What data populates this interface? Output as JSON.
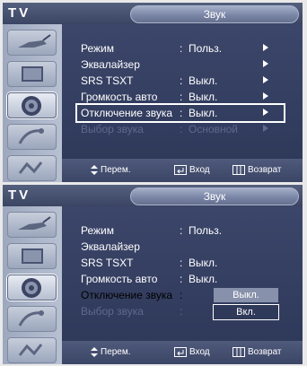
{
  "screens": [
    {
      "tv_label": "TV",
      "title": "Звук",
      "rows": [
        {
          "label": "Режим",
          "sep": ":",
          "value": "Польз."
        },
        {
          "label": "Эквалайзер",
          "sep": "",
          "value": ""
        },
        {
          "label": "SRS TSXT",
          "sep": ":",
          "value": "Выкл."
        },
        {
          "label": "Громкость авто",
          "sep": ":",
          "value": "Выкл."
        },
        {
          "label": "Отключение звука",
          "sep": ":",
          "value": "Выкл."
        },
        {
          "label": "Выбор звука",
          "sep": ":",
          "value": "Основной"
        }
      ],
      "footer": {
        "move": "Перем.",
        "enter": "Вход",
        "return": "Возврат"
      }
    },
    {
      "tv_label": "TV",
      "title": "Звук",
      "rows": [
        {
          "label": "Режим",
          "sep": ":",
          "value": "Польз."
        },
        {
          "label": "Эквалайзер",
          "sep": "",
          "value": ""
        },
        {
          "label": "SRS TSXT",
          "sep": ":",
          "value": "Выкл."
        },
        {
          "label": "Громкость авто",
          "sep": ":",
          "value": "Выкл."
        },
        {
          "label": "Отключение звука",
          "sep": ":",
          "value": ""
        },
        {
          "label": "Выбор звука",
          "sep": ":",
          "value": ""
        }
      ],
      "dropdown": {
        "options": [
          "Выкл.",
          "Вкл."
        ],
        "selected": "Вкл."
      },
      "footer": {
        "move": "Перем.",
        "enter": "Вход",
        "return": "Возврат"
      }
    }
  ],
  "icons": [
    "antenna-icon",
    "tv-screen-icon",
    "speaker-icon",
    "satellite-icon",
    "settings-icon"
  ],
  "colors": {
    "title_bar": "#3a4463",
    "content_bg": "#2f395a",
    "sidebar": "#b8c0d2",
    "dim_text": "#5d6a8c",
    "highlight": "#ffffff"
  }
}
